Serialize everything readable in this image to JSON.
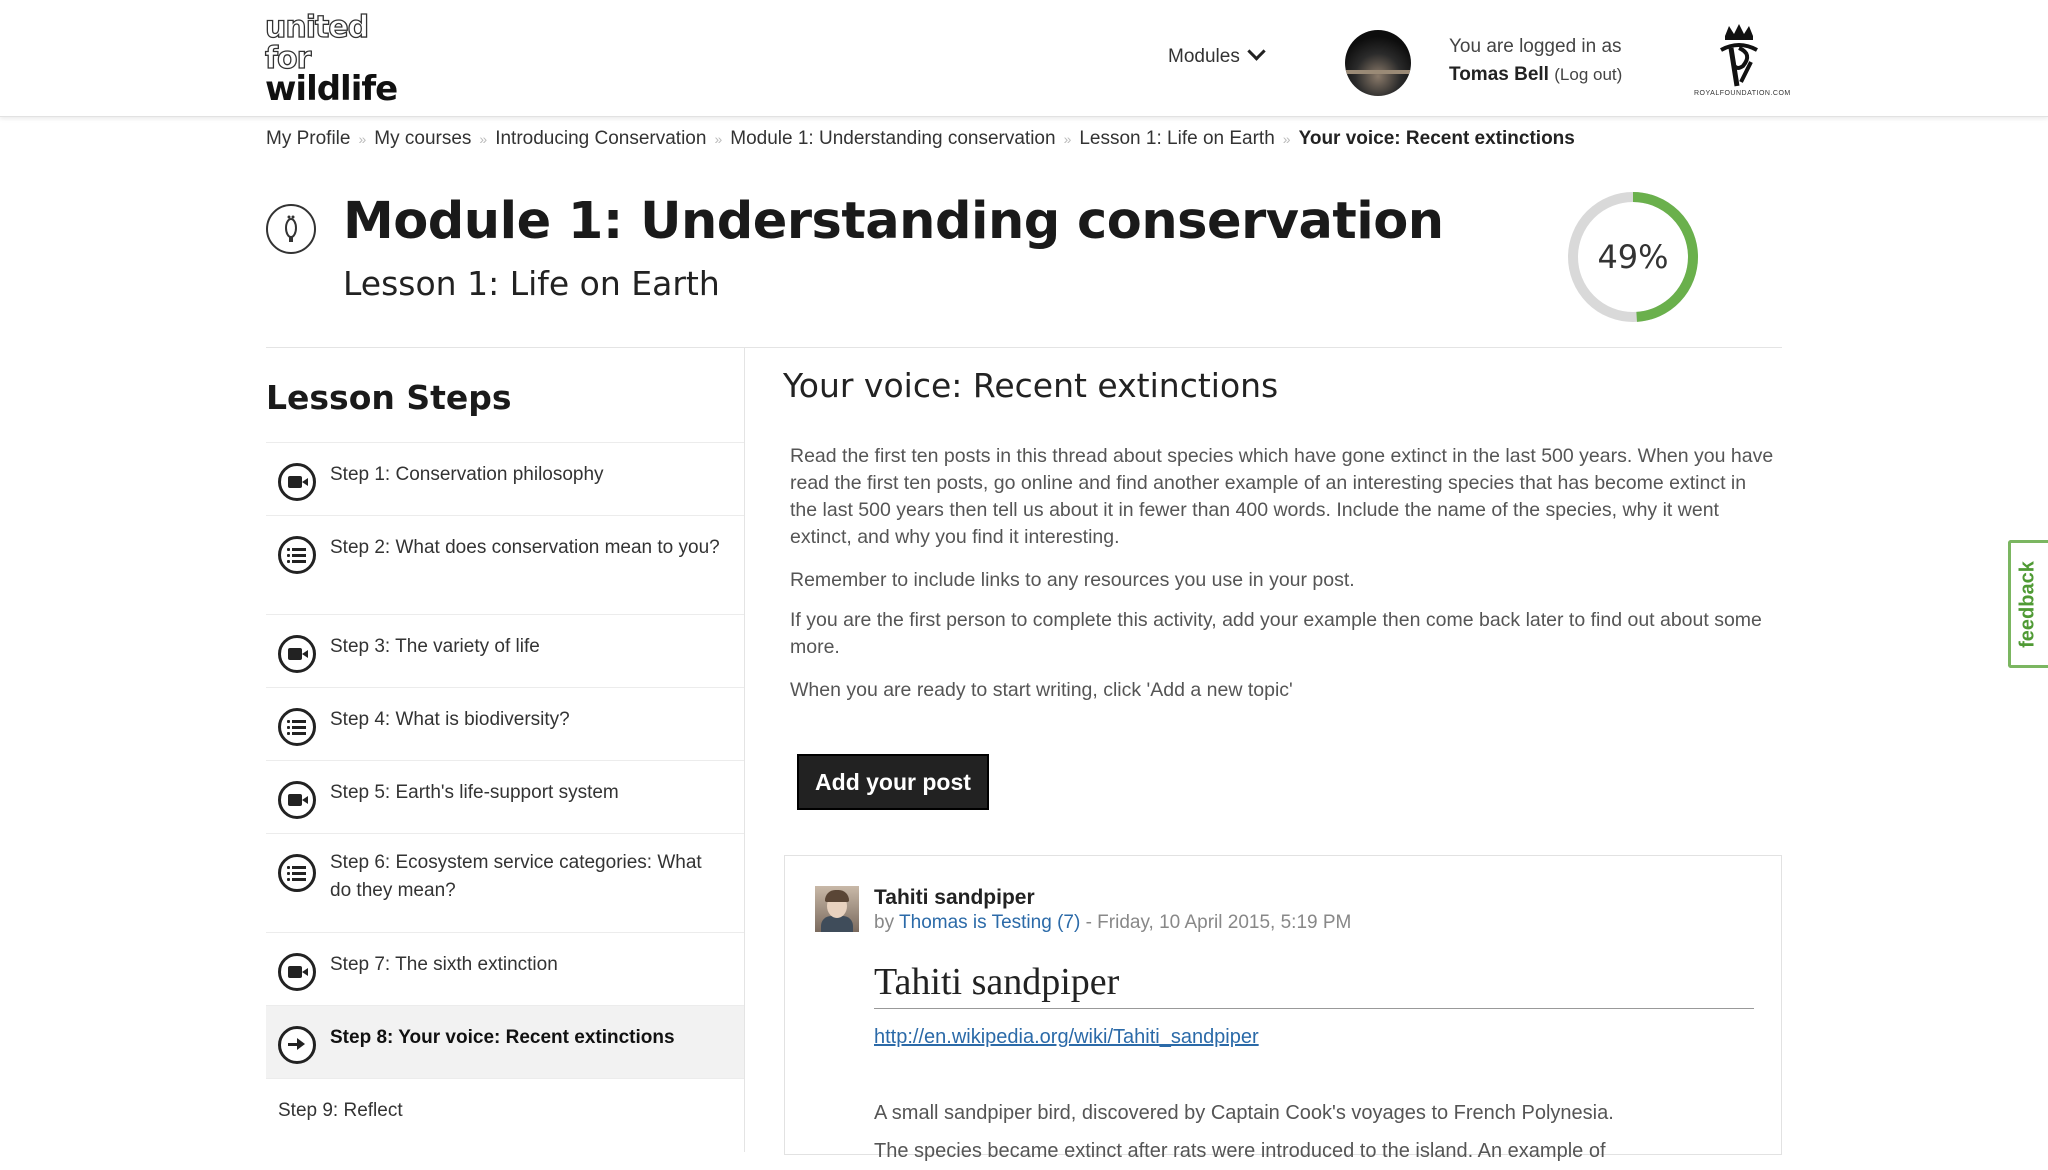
{
  "header": {
    "logo": {
      "line1": "united",
      "line2": "for",
      "line3": "wildlife"
    },
    "modules_label": "Modules",
    "login": {
      "prefix": "You are logged in as",
      "name": "Tomas Bell",
      "logout": "(Log out)"
    },
    "partner_logo_text": "ROYALFOUNDATION.COM"
  },
  "breadcrumb": [
    "My Profile",
    "My courses",
    "Introducing Conservation",
    "Module 1: Understanding conservation",
    "Lesson 1: Life on Earth",
    "Your voice: Recent extinctions"
  ],
  "page": {
    "module_title": "Module 1: Understanding conservation",
    "lesson_title": "Lesson 1: Life on Earth",
    "progress": {
      "label": "49%",
      "value": 0.49,
      "color": "#6ab04c",
      "track": "#d9d9d9"
    }
  },
  "lesson_steps": {
    "heading": "Lesson Steps",
    "items": [
      {
        "label": "Step 1: Conservation philosophy",
        "icon": "video-icon"
      },
      {
        "label": "Step 2: What does conservation mean to you?",
        "icon": "list-icon"
      },
      {
        "label": "Step 3: The variety of life",
        "icon": "video-icon"
      },
      {
        "label": "Step 4: What is biodiversity?",
        "icon": "list-icon"
      },
      {
        "label": "Step 5: Earth's life-support system",
        "icon": "video-icon"
      },
      {
        "label": "Step 6: Ecosystem service categories: What do they mean?",
        "icon": "list-icon"
      },
      {
        "label": "Step 7: The sixth extinction",
        "icon": "video-icon"
      },
      {
        "label": "Step 8: Your voice: Recent extinctions",
        "icon": "arrow-right-icon",
        "active": true
      },
      {
        "label": "Step 9: Reflect",
        "icon": ""
      }
    ]
  },
  "content": {
    "title": "Your voice: Recent extinctions",
    "paragraphs": [
      "Read the first ten posts in this thread about species which have gone extinct in the last 500 years. When you have read the first ten posts, go online and find another example of an interesting species that has become extinct in the last 500 years then tell us about it in fewer than 400 words. Include the name of the species, why it went extinct, and why you find it interesting.",
      "Remember to include links to any resources you use in your post.",
      "If you are the first person to complete this activity, add your example then come back later to find out about some more.",
      "When you are ready to start writing, click 'Add a new topic'"
    ],
    "add_button": "Add your post"
  },
  "post": {
    "title": "Tahiti sandpiper",
    "by_prefix": "by",
    "author": "Thomas is Testing (7)",
    "date": "- Friday, 10 April 2015, 5:19 PM",
    "heading": "Tahiti sandpiper",
    "link": "http://en.wikipedia.org/wiki/Tahiti_sandpiper",
    "body1": "A small sandpiper bird, discovered by Captain Cook's voyages to French Polynesia.",
    "body2": "The species became extinct after rats were introduced to the island. An example of"
  },
  "feedback_tab": "feedback"
}
